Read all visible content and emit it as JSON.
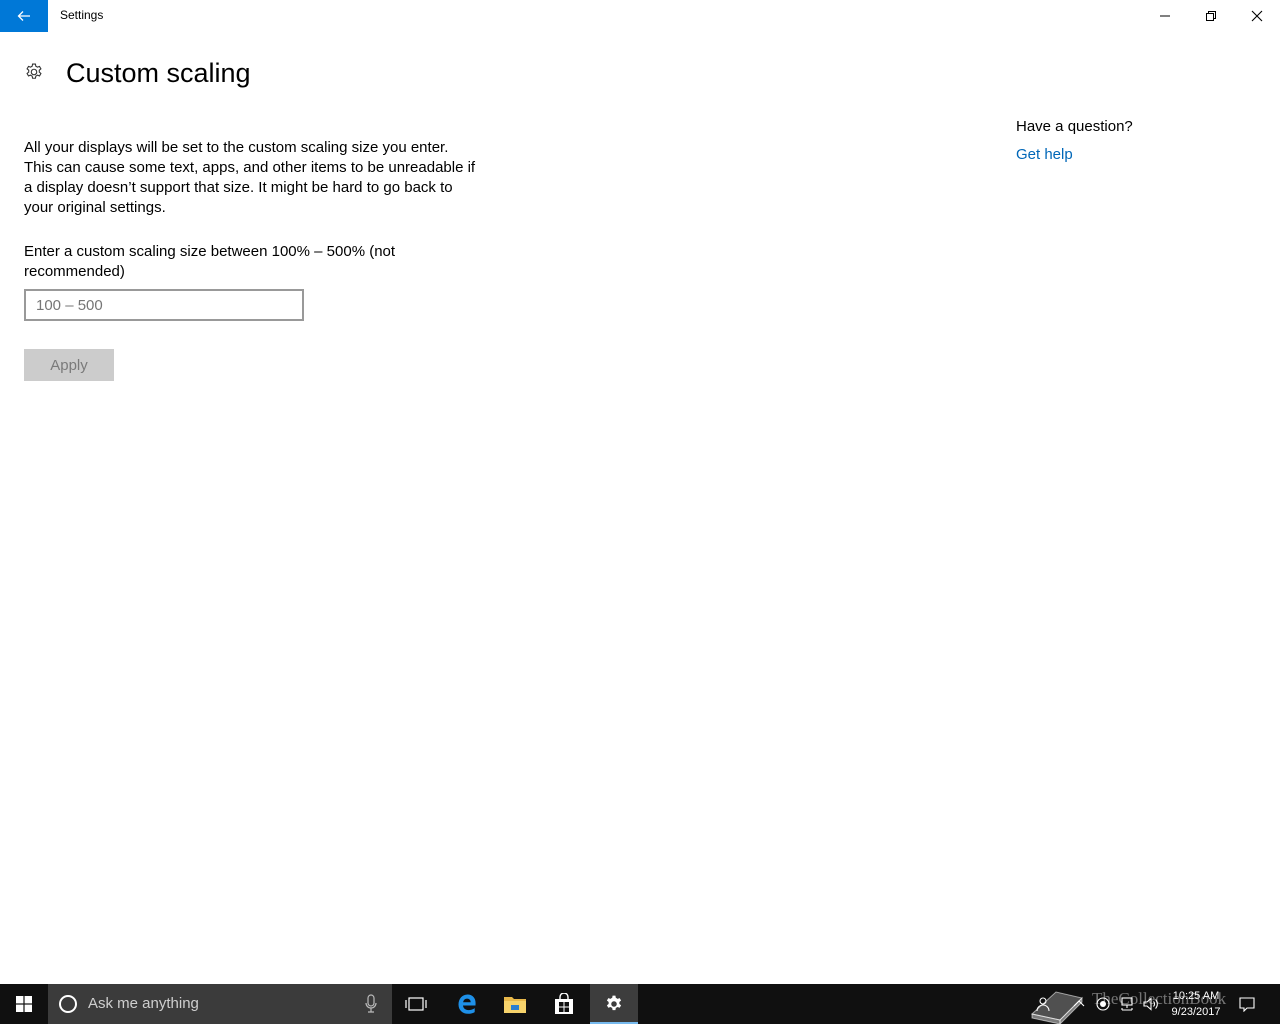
{
  "window": {
    "title": "Settings",
    "controls": [
      "minimize",
      "restore",
      "close"
    ]
  },
  "header": {
    "icon": "gear-icon",
    "title": "Custom scaling"
  },
  "main": {
    "description": "All your displays will be set to the custom scaling size you enter. This can cause some text, apps, and other items to be unreadable if a display doesn’t support that size. It might be hard to go back to your original settings.",
    "input_label": "Enter a custom scaling size between 100% – 500% (not recommended)",
    "input_value": "",
    "input_placeholder": "100 – 500",
    "apply_label": "Apply"
  },
  "help": {
    "question": "Have a question?",
    "link": "Get help"
  },
  "taskbar": {
    "search_placeholder": "Ask me anything",
    "pinned_apps": [
      "task-view-icon",
      "edge-icon",
      "file-explorer-icon",
      "store-icon",
      "settings-icon"
    ],
    "active_app": "settings-icon",
    "time": "10:25 AM",
    "date": "9/23/2017"
  },
  "watermark": {
    "text": "TheCollectionBook"
  },
  "colors": {
    "accent": "#0078d7",
    "link": "#0067b8",
    "taskbar": "#101010",
    "search_box": "#3b3b3b",
    "disabled_button": "#cccccc"
  }
}
